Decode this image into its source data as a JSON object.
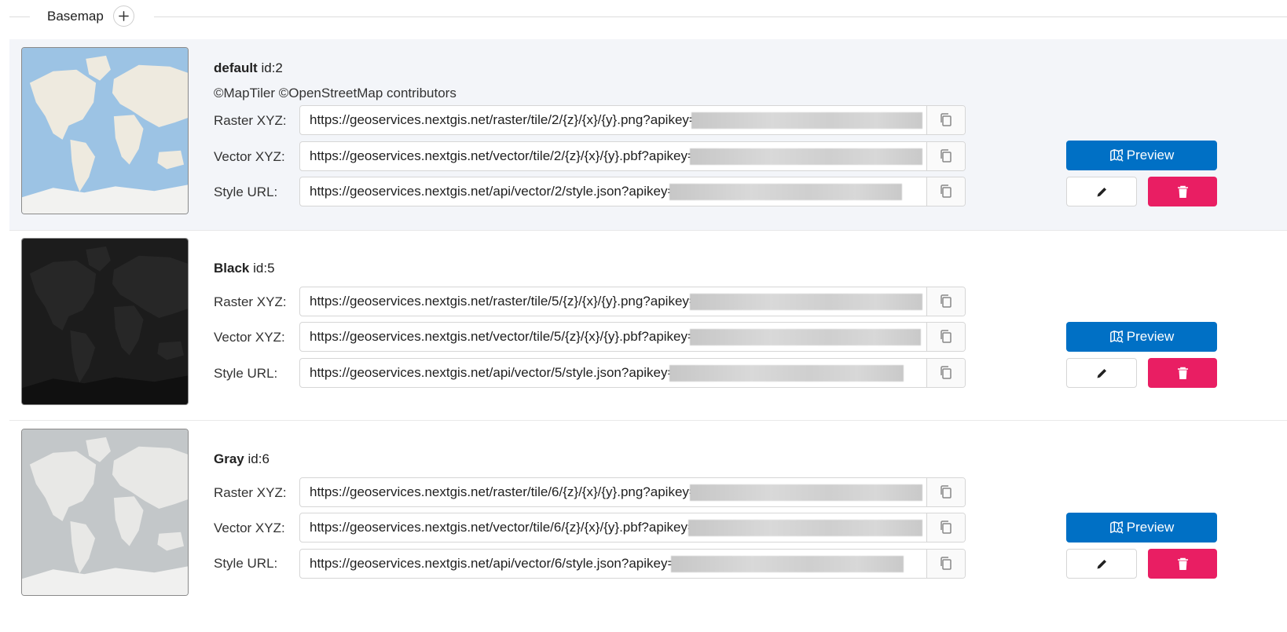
{
  "section": {
    "title": "Basemap",
    "add_icon": "plus-icon"
  },
  "colors": {
    "preview": "#0070c5",
    "delete": "#e91e63",
    "selected_row_bg": "#f3f5f9"
  },
  "basemaps": [
    {
      "name": "default",
      "id_text": "id:2",
      "attribution": "©MapTiler ©OpenStreetMap contributors",
      "thumbnail": "map-thumbnail-default",
      "fields": [
        {
          "label": "Raster XYZ:",
          "url": "https://geoservices.nextgis.net/raster/tile/2/{z}/{x}/{y}.png?apikey="
        },
        {
          "label": "Vector XYZ:",
          "url": "https://geoservices.nextgis.net/vector/tile/2/{z}/{x}/{y}.pbf?apikey="
        },
        {
          "label": "Style URL:",
          "url": "https://geoservices.nextgis.net/api/vector/2/style.json?apikey="
        }
      ],
      "preview_label": "Preview"
    },
    {
      "name": "Black",
      "id_text": "id:5",
      "thumbnail": "map-thumbnail-black",
      "fields": [
        {
          "label": "Raster XYZ:",
          "url": "https://geoservices.nextgis.net/raster/tile/5/{z}/{x}/{y}.png?apikey="
        },
        {
          "label": "Vector XYZ:",
          "url": "https://geoservices.nextgis.net/vector/tile/5/{z}/{x}/{y}.pbf?apikey="
        },
        {
          "label": "Style URL:",
          "url": "https://geoservices.nextgis.net/api/vector/5/style.json?apikey="
        }
      ],
      "preview_label": "Preview"
    },
    {
      "name": "Gray",
      "id_text": "id:6",
      "thumbnail": "map-thumbnail-gray",
      "fields": [
        {
          "label": "Raster XYZ:",
          "url": "https://geoservices.nextgis.net/raster/tile/6/{z}/{x}/{y}.png?apikey="
        },
        {
          "label": "Vector XYZ:",
          "url": "https://geoservices.nextgis.net/vector/tile/6/{z}/{x}/{y}.pbf?apikey="
        },
        {
          "label": "Style URL:",
          "url": "https://geoservices.nextgis.net/api/vector/6/style.json?apikey="
        }
      ],
      "preview_label": "Preview"
    }
  ]
}
